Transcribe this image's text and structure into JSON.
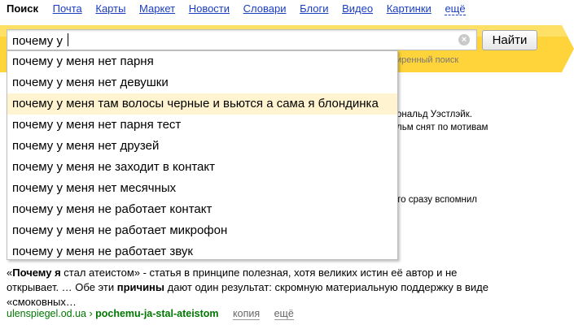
{
  "nav": {
    "current": "Поиск",
    "links": [
      "Почта",
      "Карты",
      "Маркет",
      "Новости",
      "Словари",
      "Блоги",
      "Видео",
      "Картинки"
    ],
    "more": "ещё"
  },
  "search": {
    "value": "почему у ",
    "button_label": "Найти",
    "hint_fragment": "иренный поиск"
  },
  "suggestions": [
    "почему у меня нет парня",
    "почему у меня нет девушки",
    "почему у меня там волосы черные и вьются а сама я блондинка",
    "почему у меня нет парня тест",
    "почему у меня нет друзей",
    "почему у меня не заходит в контакт",
    "почему у меня нет месячных",
    "почему у меня не работает контакт",
    "почему у меня не работает микрофон",
    "почему у меня не работает звук"
  ],
  "active_suggestion_index": 2,
  "background_fragments": {
    "line1": "ональд Уэстлэйк.",
    "line2": "льм снят по мотивам",
    "line3": "то сразу вспомнил"
  },
  "result": {
    "open_quote": "«",
    "title_bold": "Почему я",
    "title_rest": " стал атеистом»",
    "snippet1": " - статья в принципе полезная, хотя великих истин её автор и не открывает. … Обе эти ",
    "snippet_bold": "причины",
    "snippet2": " дают один результат: скромную материальную поддержку в виде «смоковных…",
    "host": "ulenspiegel.od.ua",
    "sep": " › ",
    "path": "pochemu-ja-stal-ateistom",
    "copy_label": "копия",
    "more_label": "ещё"
  },
  "colors": {
    "accent": "#ffcc00",
    "link": "#1a3dc1",
    "url": "#007700",
    "highlight": "#fff4cf"
  }
}
